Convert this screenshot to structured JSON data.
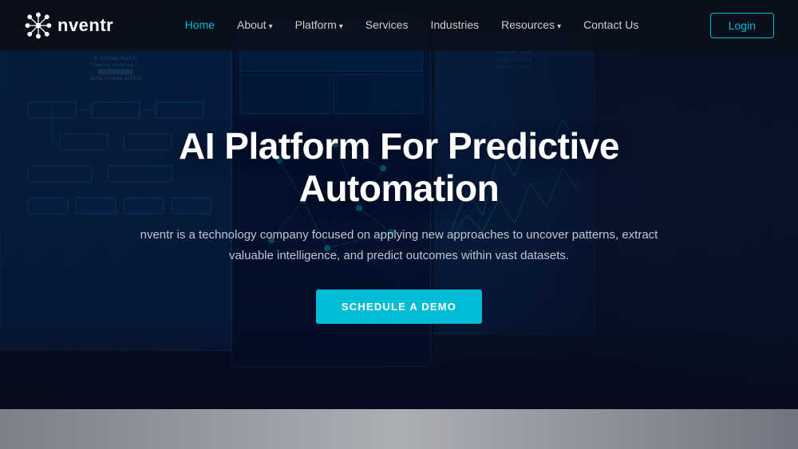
{
  "brand": {
    "name": "nventr",
    "logo_alt": "nventr logo"
  },
  "nav": {
    "links": [
      {
        "id": "home",
        "label": "Home",
        "active": true,
        "has_dropdown": false
      },
      {
        "id": "about",
        "label": "About",
        "active": false,
        "has_dropdown": true
      },
      {
        "id": "platform",
        "label": "Platform",
        "active": false,
        "has_dropdown": true
      },
      {
        "id": "services",
        "label": "Services",
        "active": false,
        "has_dropdown": false
      },
      {
        "id": "industries",
        "label": "Industries",
        "active": false,
        "has_dropdown": false
      },
      {
        "id": "resources",
        "label": "Resources",
        "active": false,
        "has_dropdown": true
      },
      {
        "id": "contact",
        "label": "Contact Us",
        "active": false,
        "has_dropdown": false
      }
    ],
    "login_label": "Login"
  },
  "hero": {
    "title": "AI Platform For Predictive Automation",
    "subtitle": "nventr is a technology company focused on applying new approaches to uncover patterns, extract valuable intelligence, and predict outcomes within vast datasets.",
    "cta_label": "SCHEDULE A DEMO"
  }
}
